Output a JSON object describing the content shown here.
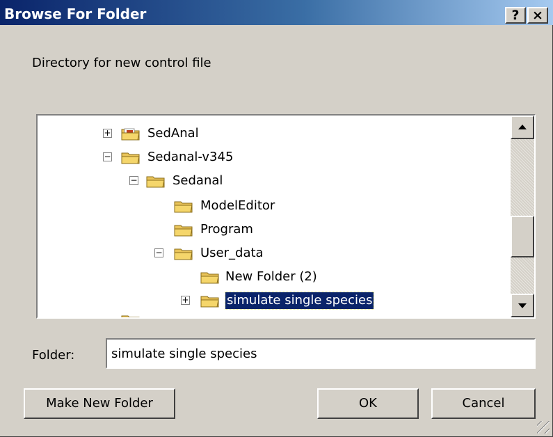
{
  "window": {
    "title": "Browse For Folder",
    "help_button": "?",
    "close_button": "×"
  },
  "prompt": "Directory for new control file",
  "tree": {
    "nodes": [
      {
        "label": "SedAnal",
        "expander": "+",
        "icon": "folder-with-files-icon"
      },
      {
        "label": "Sedanal-v345",
        "expander": "−",
        "icon": "open-folder-icon"
      },
      {
        "label": "Sedanal",
        "expander": "−",
        "icon": "open-folder-icon"
      },
      {
        "label": "ModelEditor",
        "expander": "",
        "icon": "folder-icon"
      },
      {
        "label": "Program",
        "expander": "",
        "icon": "folder-icon"
      },
      {
        "label": "User_data",
        "expander": "−",
        "icon": "open-folder-icon"
      },
      {
        "label": "New Folder (2)",
        "expander": "",
        "icon": "folder-icon"
      },
      {
        "label": "simulate single species",
        "expander": "+",
        "icon": "folder-icon",
        "selected": true
      }
    ]
  },
  "folder_field": {
    "label": "Folder:",
    "value": "simulate single species"
  },
  "buttons": {
    "make_new_folder": "Make New Folder",
    "ok": "OK",
    "cancel": "Cancel"
  },
  "colors": {
    "title_start": "#0a246a",
    "title_end": "#a6caf0",
    "face": "#d4d0c8",
    "selection": "#0a246a",
    "folder": "#f5d66b"
  }
}
